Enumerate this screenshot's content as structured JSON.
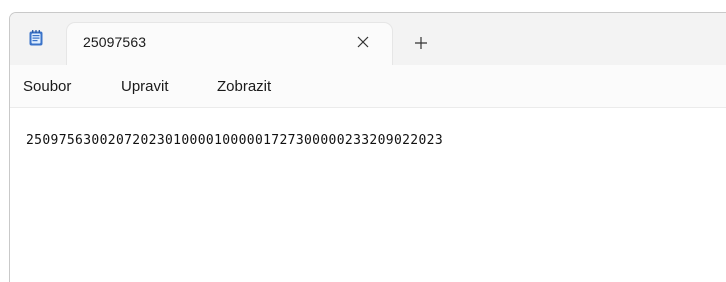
{
  "tab": {
    "title": "25097563"
  },
  "menu": {
    "file": "Soubor",
    "edit": "Upravit",
    "view": "Zobrazit"
  },
  "editor": {
    "content": "250975630020720230100001000001727300000233209022023"
  },
  "icons": {
    "app": "notepad-icon",
    "close": "close-icon",
    "new_tab": "plus-icon"
  },
  "colors": {
    "titlebar": "#f3f3f3",
    "tab": "#fbfbfb",
    "app_icon": "#3a73c9"
  }
}
